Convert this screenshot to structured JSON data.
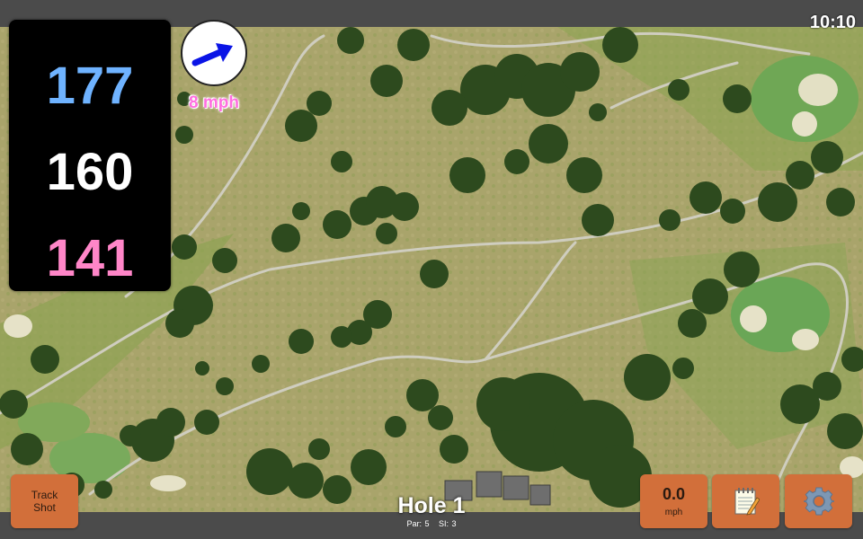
{
  "status": {
    "time": "10:10"
  },
  "yardages": {
    "back": "177",
    "center": "160",
    "front": "141"
  },
  "wind": {
    "speed": "8 mph",
    "direction_icon": "arrow-right-icon",
    "arrow_color": "#0a14e6"
  },
  "buttons": {
    "track_shot": "Track\nShot",
    "speed_value": "0.0",
    "speed_unit": "mph",
    "notes_icon": "notepad-icon",
    "settings_icon": "gear-icon"
  },
  "hole": {
    "title": "Hole 1",
    "par_label": "Par:",
    "par": "5",
    "si_label": "SI:",
    "si": "3"
  },
  "colors": {
    "back_yardage": "#6fb3ff",
    "center_yardage": "#ffffff",
    "front_yardage": "#ff86c8",
    "button": "#d26f3a",
    "wind_text": "#ff6ee0"
  }
}
